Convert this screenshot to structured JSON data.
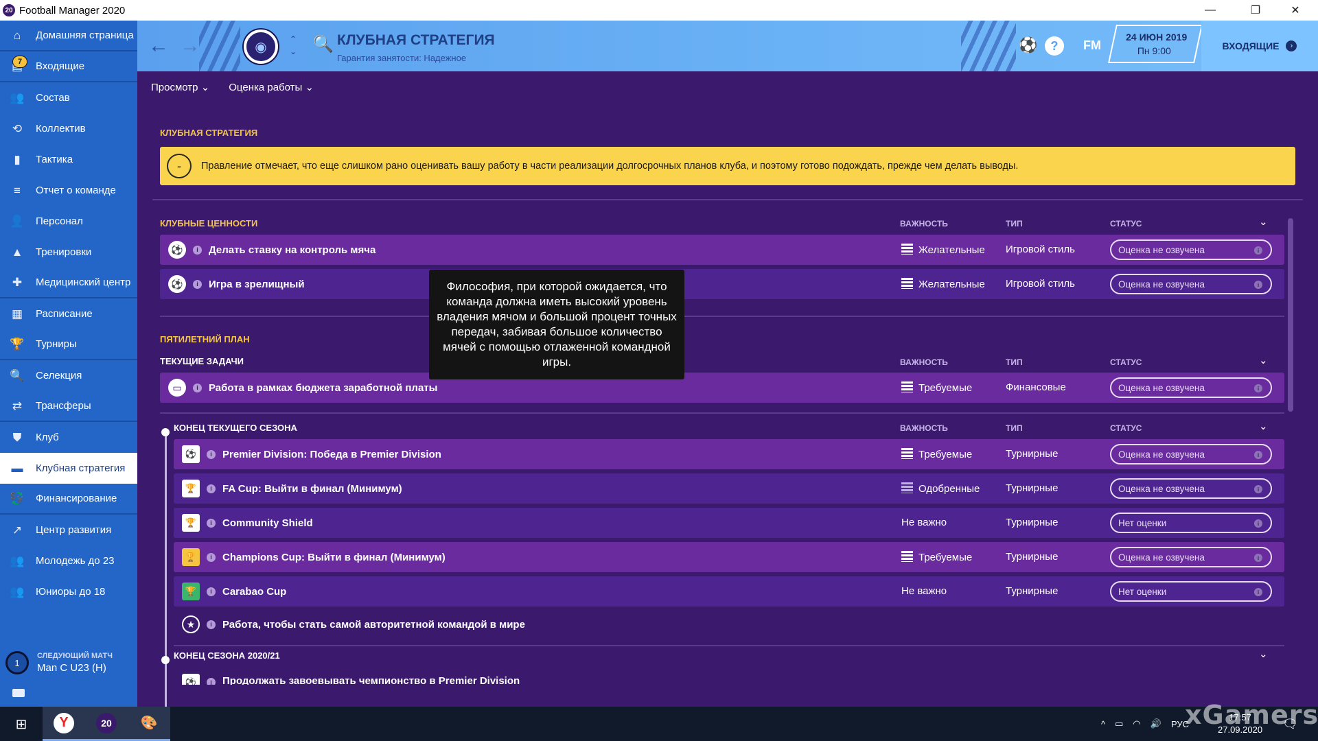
{
  "window": {
    "app_icon": "20",
    "title": "Football Manager 2020",
    "min": "—",
    "max": "❐",
    "close": "✕"
  },
  "sidebar": {
    "items": [
      {
        "label": "Домашняя страница",
        "icon": "home-icon"
      },
      {
        "label": "Входящие",
        "icon": "inbox-icon",
        "badge": "7"
      },
      {
        "label": "Состав",
        "icon": "squad-icon"
      },
      {
        "label": "Коллектив",
        "icon": "dynamics-icon"
      },
      {
        "label": "Тактика",
        "icon": "tactics-icon"
      },
      {
        "label": "Отчет о команде",
        "icon": "report-icon"
      },
      {
        "label": "Персонал",
        "icon": "staff-icon"
      },
      {
        "label": "Тренировки",
        "icon": "training-icon"
      },
      {
        "label": "Медицинский центр",
        "icon": "medical-icon"
      },
      {
        "label": "Расписание",
        "icon": "calendar-icon"
      },
      {
        "label": "Турниры",
        "icon": "trophy-icon"
      },
      {
        "label": "Селекция",
        "icon": "scouting-icon"
      },
      {
        "label": "Трансферы",
        "icon": "transfers-icon"
      },
      {
        "label": "Клуб",
        "icon": "club-icon"
      },
      {
        "label": "Клубная стратегия",
        "icon": "club-vision-icon"
      },
      {
        "label": "Финансирование",
        "icon": "finances-icon"
      },
      {
        "label": "Центр развития",
        "icon": "development-icon"
      },
      {
        "label": "Молодежь до 23",
        "icon": "u23-icon"
      },
      {
        "label": "Юниоры до 18",
        "icon": "u18-icon"
      }
    ],
    "next_match": {
      "label": "СЛЕДУЮЩИЙ МАТЧ",
      "value": "Man C U23 (H)",
      "number": "1"
    }
  },
  "header": {
    "title": "КЛУБНАЯ СТРАТЕГИЯ",
    "subtitle": "Гарантия занятости: Надежное",
    "date": "24 ИЮН 2019",
    "time": "Пн 9:00",
    "inbox_button": "ВХОДЯЩИЕ",
    "fm_label": "FM",
    "help_label": "?"
  },
  "subnav": {
    "view": "Просмотр",
    "evaluation": "Оценка работы"
  },
  "main": {
    "strategy_heading": "КЛУБНАЯ СТРАТЕГИЯ",
    "warning_text": "Правление отмечает, что еще слишком рано оценивать вашу работу в части реализации долгосрочных планов клуба, и поэтому готово подождать, прежде чем делать выводы.",
    "warning_icon": "-",
    "values_heading": "КЛУБНЫЕ ЦЕННОСТИ",
    "col_importance": "ВАЖНОСТЬ",
    "col_type": "ТИП",
    "col_status": "СТАТУС",
    "values_rows": [
      {
        "title": "Делать ставку на контроль мяча",
        "importance": "Желательные",
        "type": "Игровой стиль",
        "status": "Оценка не озвучена"
      },
      {
        "title": "Игра в зрелищный",
        "importance": "Желательные",
        "type": "Игровой стиль",
        "status": "Оценка не озвучена"
      }
    ],
    "five_year_heading": "ПЯТИЛЕТНИЙ ПЛАН",
    "current_tasks_heading": "ТЕКУЩИЕ ЗАДАЧИ",
    "current_rows": [
      {
        "title": "Работа в рамках бюджета заработной платы",
        "importance": "Требуемые",
        "type": "Финансовые",
        "status": "Оценка не озвучена"
      }
    ],
    "season_end_heading": "КОНЕЦ ТЕКУЩЕГО СЕЗОНА",
    "season_rows": [
      {
        "title": "Premier Division: Победа в Premier Division",
        "importance": "Требуемые",
        "type": "Турнирные",
        "status": "Оценка не озвучена"
      },
      {
        "title": "FA Cup: Выйти в финал (Минимум)",
        "importance": "Одобренные",
        "type": "Турнирные",
        "status": "Оценка не озвучена"
      },
      {
        "title": "Community Shield",
        "importance": "Не важно",
        "type": "Турнирные",
        "status": "Нет оценки"
      },
      {
        "title": "Champions Cup: Выйти в финал (Минимум)",
        "importance": "Требуемые",
        "type": "Турнирные",
        "status": "Оценка не озвучена"
      },
      {
        "title": "Carabao Cup",
        "importance": "Не важно",
        "type": "Турнирные",
        "status": "Нет оценки"
      }
    ],
    "world_row": "Работа, чтобы стать самой авторитетной командой в мире",
    "season_2021_heading": "КОНЕЦ СЕЗОНА 2020/21",
    "partial_row": "Продолжать завоевывать чемпионство в Premier Division",
    "tooltip": "Философия, при которой ожидается, что команда должна иметь высокий уровень владения мячом и большой процент точных передач, забивая большое количество мячей с помощью отлаженной командной игры."
  },
  "taskbar": {
    "lang": "РУС",
    "time": "17:57",
    "date": "27.09.2020",
    "app_label": "20"
  },
  "watermark": "xGamers",
  "colors": {
    "sidebar": "#2366c8",
    "header": "#6bb3f6",
    "content": "#3b1a6e",
    "highlight_row": "#6a2b9f",
    "accent": "#f5c542"
  }
}
